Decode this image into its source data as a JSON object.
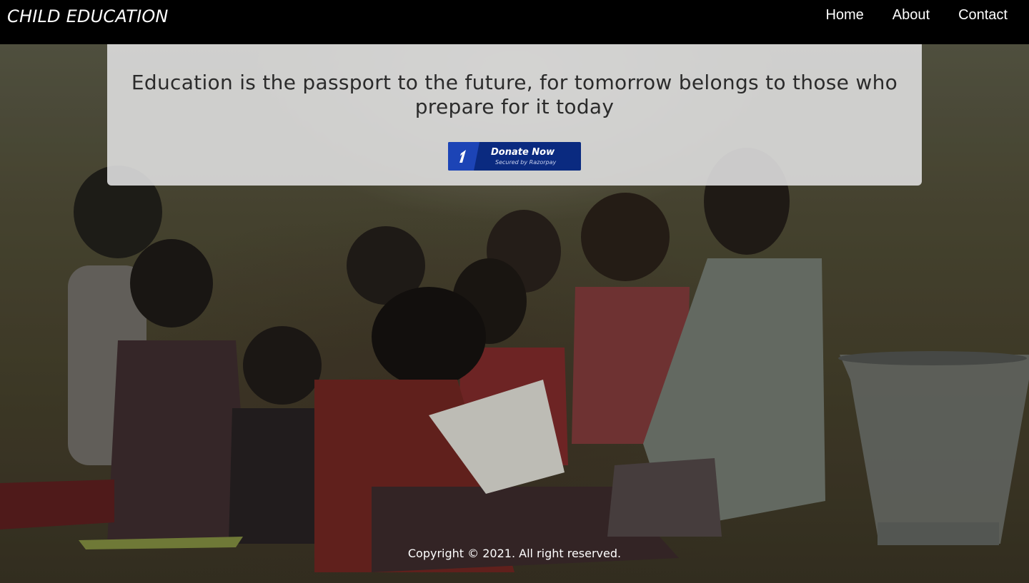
{
  "header": {
    "brand": "CHILD EDUCATION",
    "nav": [
      "Home",
      "About",
      "Contact"
    ]
  },
  "hero": {
    "image_icon": "children-photo",
    "quote": "Education is the passport to the future, for tomorrow belongs to those who prepare for it today",
    "donate_button": {
      "label": "Donate Now",
      "sublabel": "Secured by Razorpay",
      "icon": "razorpay-icon"
    }
  },
  "footer": {
    "copyright": "Copyright © 2021. All right reserved."
  },
  "colors": {
    "header_bg": "#000000",
    "card_bg": "#dedede",
    "donate_bg": "#0a2a80",
    "donate_logo_bg": "#1c44b6",
    "text_light": "#ffffff",
    "text_dark": "#2b2b2b"
  }
}
